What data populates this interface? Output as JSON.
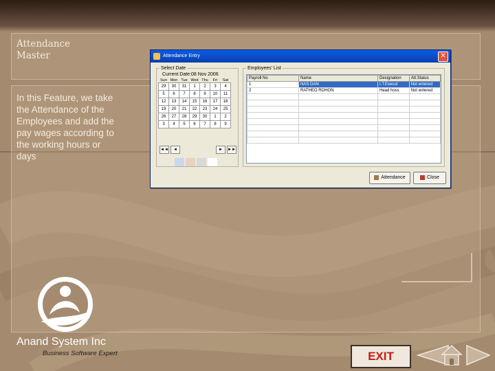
{
  "slide": {
    "title_line1": "Attendance",
    "title_line2": "Master",
    "description": "In this Feature, we take the Attendance of the Employees and add the pay wages according to the working hours or days"
  },
  "company": {
    "name": "Anand System Inc",
    "tagline": "Business Software Expert"
  },
  "dialog": {
    "title": "Attendance Entry",
    "close_label": "✕",
    "select_date_label": "Select Date",
    "current_date_label": "Current Date:08 Nov 2006",
    "day_headers": [
      "Sun",
      "Mon",
      "Tue",
      "Wed",
      "Thu",
      "Fri",
      "Sat"
    ],
    "calendar_rows": [
      [
        "29",
        "30",
        "31",
        "1",
        "2",
        "3",
        "4"
      ],
      [
        "5",
        "6",
        "7",
        "8",
        "9",
        "10",
        "11"
      ],
      [
        "12",
        "13",
        "14",
        "15",
        "16",
        "17",
        "18"
      ],
      [
        "19",
        "20",
        "21",
        "22",
        "23",
        "24",
        "25"
      ],
      [
        "26",
        "27",
        "28",
        "29",
        "30",
        "1",
        "2"
      ],
      [
        "3",
        "4",
        "5",
        "6",
        "7",
        "8",
        "9"
      ]
    ],
    "nav": {
      "first": "◄◄",
      "prev": "◄",
      "next": "►",
      "last": "►►"
    },
    "employees_list_label": "Employees' List",
    "columns": [
      "Payroll No",
      "Name",
      "Designation",
      "Att.Status"
    ],
    "rows": [
      [
        "1",
        "NAS DAN",
        "I.T.Execut",
        "Not entered"
      ],
      [
        "2",
        "RATHEO ROHON",
        "Head hoss",
        "Not entered"
      ]
    ],
    "attendance_button": "Attendance",
    "close_button": "Close"
  },
  "footer": {
    "exit_label": "EXIT"
  }
}
